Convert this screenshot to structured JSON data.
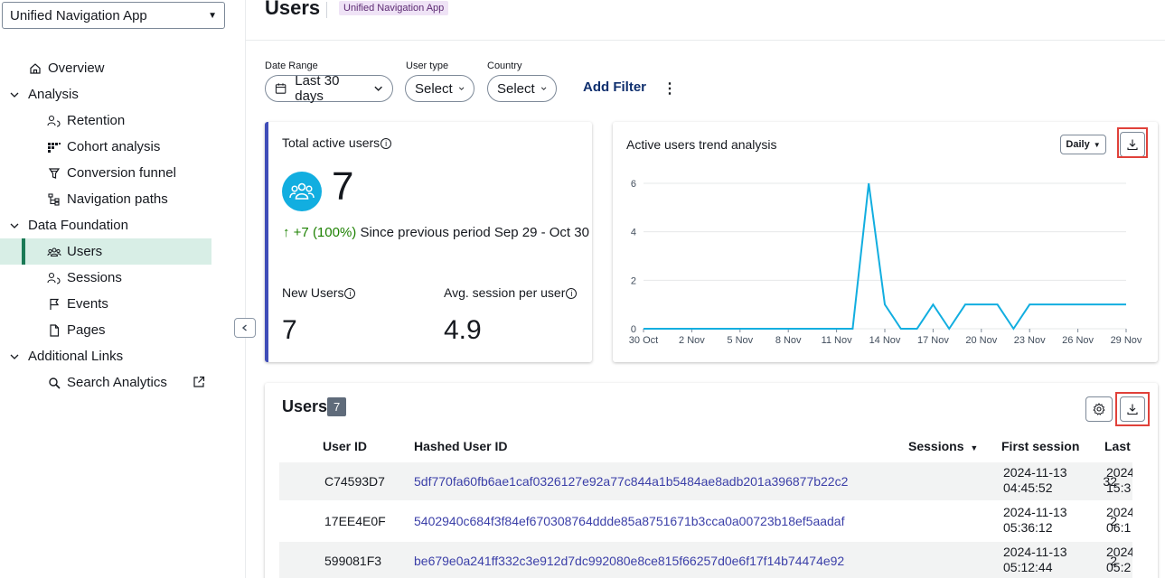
{
  "sidebar": {
    "app_select": "Unified Navigation App",
    "items": [
      {
        "label": "Overview"
      },
      {
        "label": "Analysis"
      },
      {
        "label": "Retention"
      },
      {
        "label": "Cohort analysis"
      },
      {
        "label": "Conversion funnel"
      },
      {
        "label": "Navigation paths"
      },
      {
        "label": "Data Foundation"
      },
      {
        "label": "Users"
      },
      {
        "label": "Sessions"
      },
      {
        "label": "Events"
      },
      {
        "label": "Pages"
      },
      {
        "label": "Additional Links"
      },
      {
        "label": "Search Analytics"
      }
    ],
    "active_item": "Users"
  },
  "header": {
    "title": "Users",
    "badge": "Unified Navigation App"
  },
  "filters": {
    "date_range": {
      "label": "Date Range",
      "value": "Last 30 days"
    },
    "user_type": {
      "label": "User type",
      "value": "Select"
    },
    "country": {
      "label": "Country",
      "value": "Select"
    },
    "add_filter": "Add Filter",
    "more": "⋮"
  },
  "kpi": {
    "title": "Total active users",
    "value": "7",
    "trend_arrow": "↑",
    "trend_value": "+7 (100%)",
    "trend_text": "Since previous period Sep 29 - Oct 30",
    "new_users_label": "New Users",
    "new_users_value": "7",
    "avg_session_label": "Avg. session per user",
    "avg_session_value": "4.9"
  },
  "trend_chart": {
    "title": "Active users trend analysis",
    "granularity": "Daily",
    "line_color": "#12aee0"
  },
  "chart_data": {
    "type": "line",
    "title": "Active users trend analysis",
    "xlabel": "",
    "ylabel": "",
    "x": [
      "30 Oct",
      "31 Oct",
      "1 Nov",
      "2 Nov",
      "3 Nov",
      "4 Nov",
      "5 Nov",
      "6 Nov",
      "7 Nov",
      "8 Nov",
      "9 Nov",
      "10 Nov",
      "11 Nov",
      "12 Nov",
      "13 Nov",
      "14 Nov",
      "15 Nov",
      "16 Nov",
      "17 Nov",
      "18 Nov",
      "19 Nov",
      "20 Nov",
      "21 Nov",
      "22 Nov",
      "23 Nov",
      "24 Nov",
      "25 Nov",
      "26 Nov",
      "27 Nov",
      "28 Nov",
      "29 Nov"
    ],
    "series": [
      {
        "values": [
          0,
          0,
          0,
          0,
          0,
          0,
          0,
          0,
          0,
          0,
          0,
          0,
          0,
          0,
          6,
          1,
          0,
          0,
          1,
          0,
          1,
          1,
          1,
          0,
          1,
          1,
          1,
          1,
          1,
          1,
          1
        ]
      }
    ],
    "x_tick_labels": [
      "30 Oct",
      "2 Nov",
      "5 Nov",
      "8 Nov",
      "11 Nov",
      "14 Nov",
      "17 Nov",
      "20 Nov",
      "23 Nov",
      "26 Nov",
      "29 Nov"
    ],
    "y_ticks": [
      0,
      2,
      4,
      6
    ],
    "ylim": [
      0,
      6
    ],
    "grid": true
  },
  "users_table": {
    "title": "Users",
    "count": "7",
    "columns": [
      "User ID",
      "Hashed User ID",
      "Sessions",
      "First session",
      "Last"
    ],
    "sort_indicator": "▼",
    "rows": [
      {
        "user_id": "C74593D7",
        "hash": "5df770fa60fb6ae1caf0326127e92a77c844a1b5484ae8adb201a396877b22c2",
        "sessions": "32",
        "first_date": "2024-11-13",
        "first_time": "04:45:52",
        "last_date": "2024",
        "last_time": "15:3"
      },
      {
        "user_id": "17EE4E0F",
        "hash": "5402940c684f3f84ef670308764ddde85a8751671b3cca0a00723b18ef5aadaf",
        "sessions": "2",
        "first_date": "2024-11-13",
        "first_time": "05:36:12",
        "last_date": "2024",
        "last_time": "06:1"
      },
      {
        "user_id": "599081F3",
        "hash": "be679e0a241ff332c3e912d7dc992080e8ce815f66257d0e6f17f14b74474e92",
        "sessions": "2",
        "first_date": "2024-11-13",
        "first_time": "05:12:44",
        "last_date": "2024",
        "last_time": "05:2"
      }
    ]
  }
}
